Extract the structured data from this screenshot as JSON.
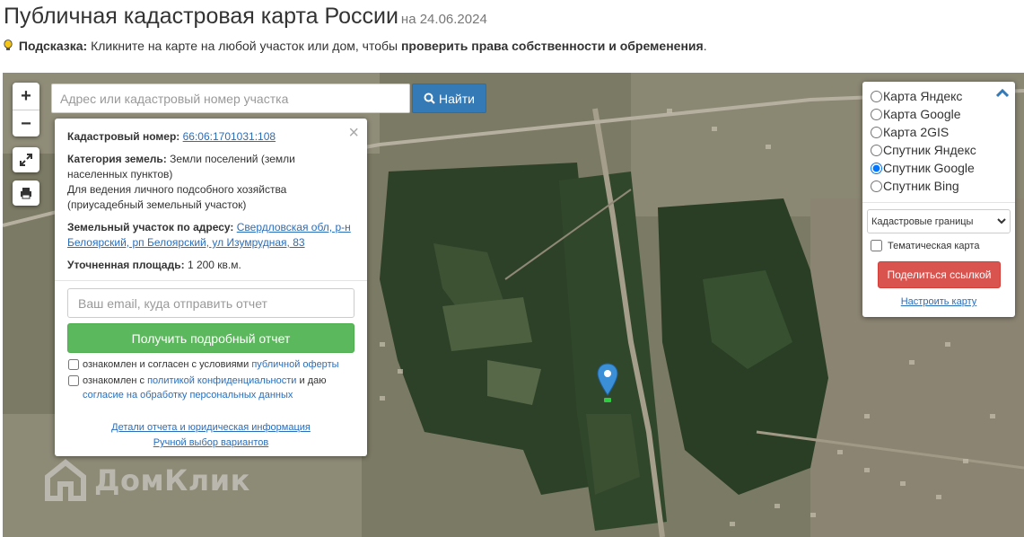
{
  "header": {
    "title": "Публичная кадастровая карта России",
    "date": "на 24.06.2024"
  },
  "hint": {
    "label": "Подсказка:",
    "text": "Кликните на карте на любой участок или дом, чтобы",
    "bold_text": "проверить права собственности и обременения",
    "end": "."
  },
  "search": {
    "placeholder": "Адрес или кадастровый номер участка",
    "button_label": "Найти"
  },
  "map_controls": {
    "zoom_in": "+",
    "zoom_out": "−"
  },
  "popup": {
    "cadastral_label": "Кадастровый номер:",
    "cadastral_number": "66:06:1701031:108",
    "category_label": "Категория земель:",
    "category_value": "Земли поселений (земли населенных пунктов)",
    "usage": "Для ведения личного подсобного хозяйства (приусадебный земельный участок)",
    "address_label": "Земельный участок по адресу:",
    "address_value": "Свердловская обл, р-н Белоярский, рп Белоярский, ул Изумрудная, 83",
    "area_label": "Уточненная площадь:",
    "area_value": "1 200 кв.м.",
    "email_placeholder": "Ваш email, куда отправить отчет",
    "report_button": "Получить подробный отчет",
    "consent1_text": "ознакомлен и согласен с условиями",
    "consent1_link": "публичной оферты",
    "consent2_text": "ознакомлен с",
    "consent2_link": "политикой конфиденциальности",
    "consent2_and": "и даю",
    "consent2_link2": "согласие на обработку персональных данных",
    "details_link": "Детали отчета и юридическая информация",
    "manual_link": "Ручной выбор вариантов"
  },
  "layers": {
    "options": [
      "Карта Яндекс",
      "Карта Google",
      "Карта 2GIS",
      "Спутник Яндекс",
      "Спутник Google",
      "Спутник Bing"
    ],
    "selected": "Спутник Google",
    "overlay_select": "Кадастровые границы",
    "thematic_label": "Тематическая карта",
    "share_button": "Поделиться ссылкой",
    "configure_link": "Настроить карту"
  },
  "watermark": {
    "text": "ДомКлик"
  },
  "icons": [
    "bulb-icon",
    "fullscreen-icon",
    "print-icon",
    "search-icon",
    "close-icon",
    "chevron-up-icon",
    "chevron-down-icon",
    "map-pin-icon",
    "domclick-logo-icon"
  ],
  "colors": {
    "primary": "#337ab7",
    "success": "#5cb85c",
    "danger": "#d9534f",
    "link": "#2a6ebb",
    "pin": "#3a8fd6"
  }
}
